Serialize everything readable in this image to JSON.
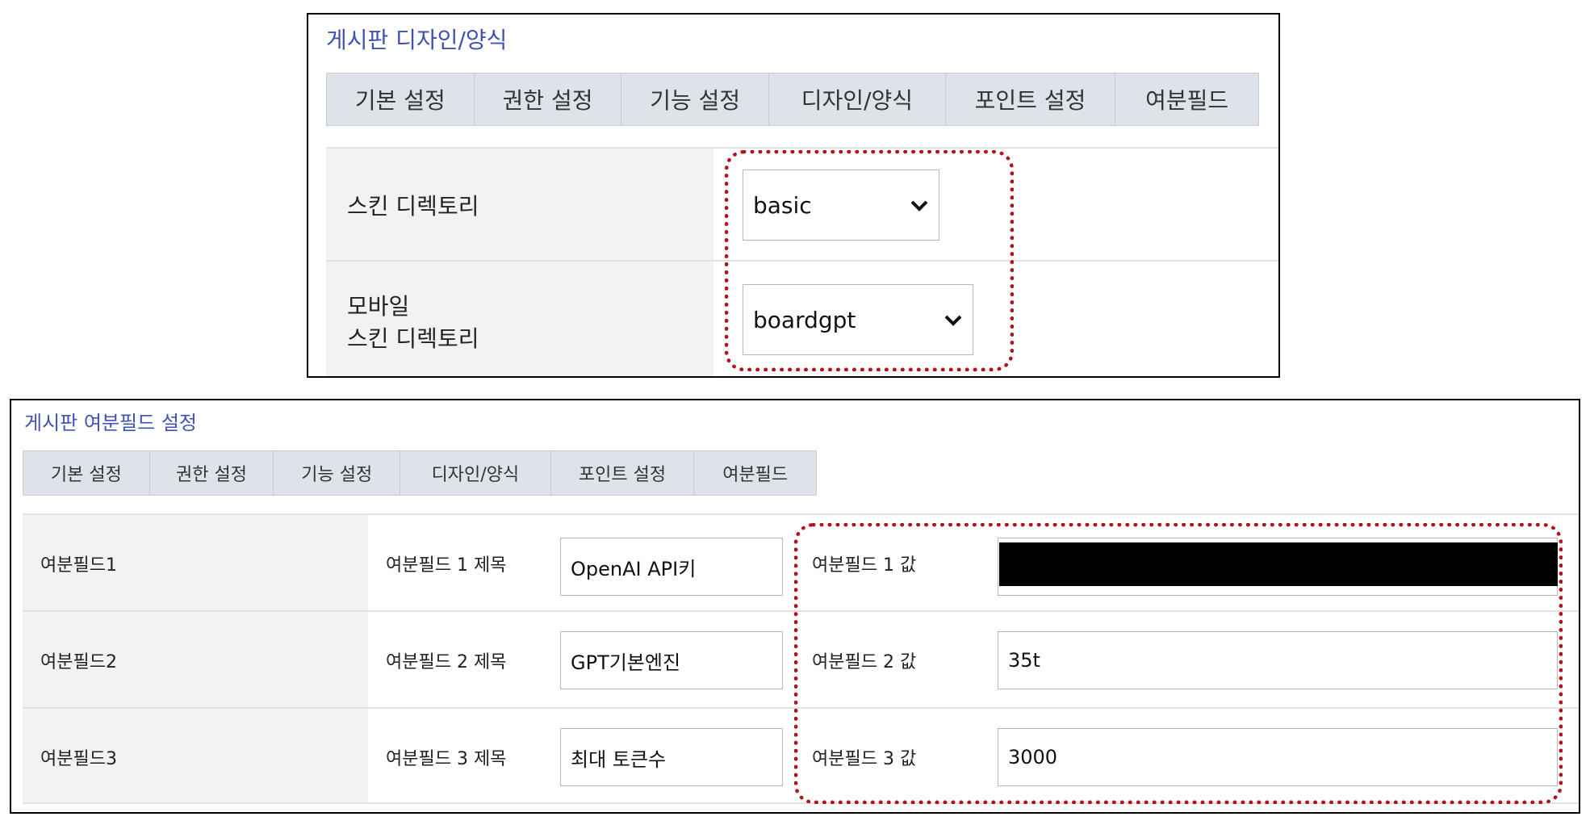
{
  "colors": {
    "title": "#3f51b5",
    "tab_bg": "#dde3e8",
    "row_gray": "#f2f2f2",
    "highlight": "#b5121b",
    "redaction": "#000000"
  },
  "top_panel": {
    "title": "게시판 디자인/양식",
    "tabs": [
      "기본 설정",
      "권한 설정",
      "기능 설정",
      "디자인/양식",
      "포인트 설정",
      "여분필드"
    ],
    "rows": [
      {
        "label": "스킨 디렉토리",
        "selected": "basic"
      },
      {
        "label_line1": "모바일",
        "label_line2": "스킨 디렉토리",
        "selected": "boardgpt"
      }
    ],
    "dropdown_icon": "chevron-down-icon"
  },
  "bottom_panel": {
    "title": "게시판 여분필드 설정",
    "tabs": [
      "기본 설정",
      "권한 설정",
      "기능 설정",
      "디자인/양식",
      "포인트 설정",
      "여분필드"
    ],
    "rows": [
      {
        "name": "여분필드1",
        "title_label": "여분필드 1 제목",
        "title_value": "OpenAI API키",
        "value_label": "여분필드 1 값",
        "value": ""
      },
      {
        "name": "여분필드2",
        "title_label": "여분필드 2 제목",
        "title_value": "GPT기본엔진",
        "value_label": "여분필드 2 값",
        "value": "35t"
      },
      {
        "name": "여분필드3",
        "title_label": "여분필드 3 제목",
        "title_value": "최대 토큰수",
        "value_label": "여분필드 3 값",
        "value": "3000"
      }
    ]
  }
}
